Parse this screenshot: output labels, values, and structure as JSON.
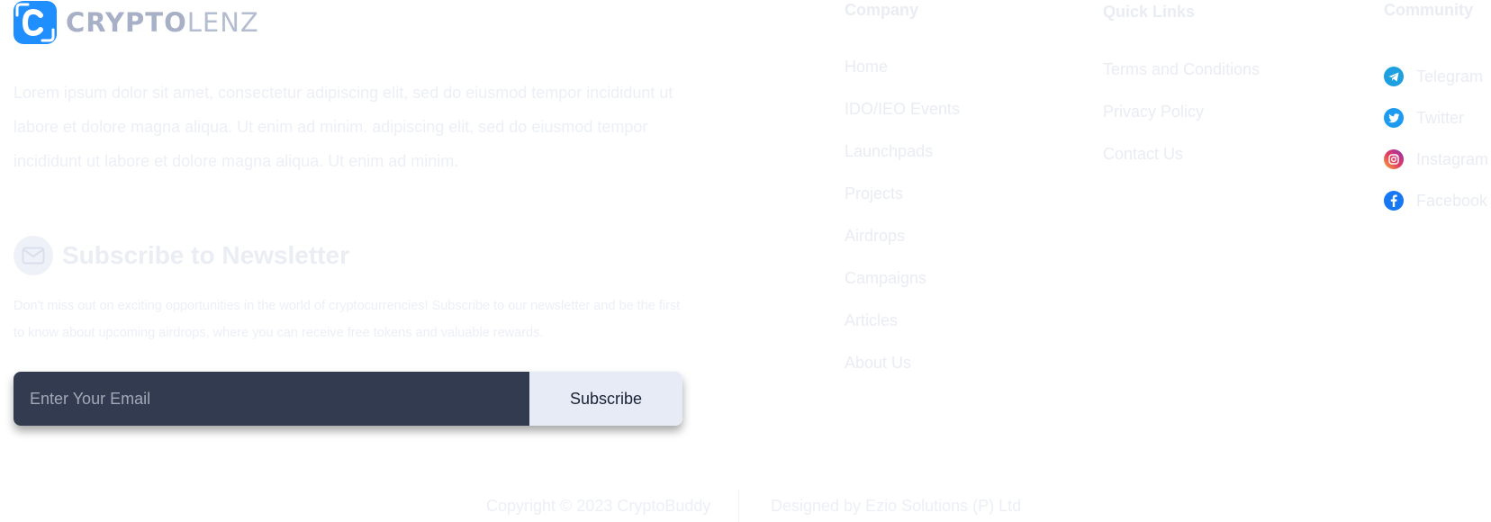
{
  "brand": {
    "name_strong": "CRYPTO",
    "name_light": "LENZ",
    "accent_color": "#1f8fff"
  },
  "about": {
    "text": "Lorem ipsum dolor sit amet, consectetur adipiscing elit, sed do eiusmod tempor incididunt ut labore et dolore magna aliqua. Ut enim ad minim. adipiscing elit, sed do eiusmod tempor incididunt ut labore et dolore magna aliqua. Ut enim ad minim."
  },
  "newsletter": {
    "icon": "mail-icon",
    "title": "Subscribe to Newsletter",
    "description": "Don't miss out on exciting opportunities in the world of cryptocurrencies! Subscribe to our newsletter and be the first to know about upcoming airdrops, where you can receive free tokens and valuable rewards.",
    "email_placeholder": "Enter Your Email",
    "email_value": "",
    "button_label": "Subscribe"
  },
  "company": {
    "title": "Company",
    "links": [
      "Home",
      "IDO/IEO Events",
      "Launchpads",
      "Projects",
      "Airdrops",
      "Campaigns",
      "Articles",
      "About Us"
    ]
  },
  "quick_links": {
    "title": "Quick Links",
    "links": [
      "Terms and Conditions",
      "Privacy Policy",
      "Contact Us"
    ]
  },
  "community": {
    "title": "Community",
    "links": [
      {
        "label": "Telegram",
        "icon": "telegram-icon"
      },
      {
        "label": "Twitter",
        "icon": "twitter-icon"
      },
      {
        "label": "Instagram",
        "icon": "instagram-icon"
      },
      {
        "label": "Facebook",
        "icon": "facebook-icon"
      }
    ]
  },
  "footer": {
    "copyright": "Copyright © 2023 CryptoBuddy",
    "designed_by": "Designed by Ezio Solutions (P) Ltd"
  }
}
